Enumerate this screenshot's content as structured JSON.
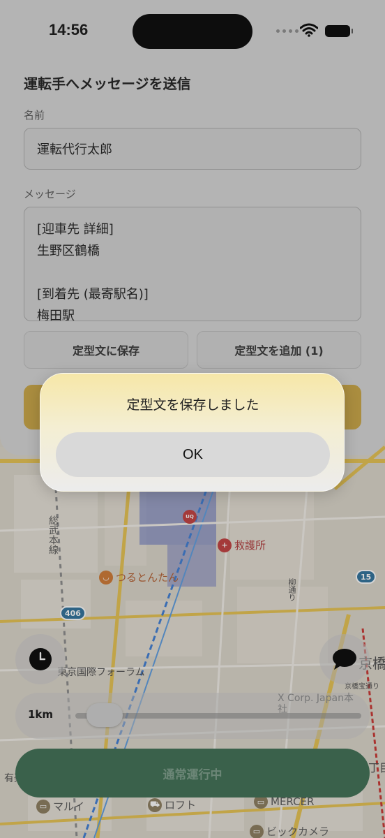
{
  "status_bar": {
    "time": "14:56",
    "wifi_icon": "wifi-icon",
    "battery_icon": "battery-icon"
  },
  "sheet": {
    "title": "運転手へメッセージを送信",
    "name_label": "名前",
    "name_value": "運転代行太郎",
    "message_label": "メッセージ",
    "message_lines": [
      "[迎車先 詳細]",
      "生野区鶴橋",
      "",
      "[到着先 (最寄駅名)]",
      "梅田駅"
    ],
    "save_template_label": "定型文に保存",
    "add_template_label": "定型文を追加 (1)",
    "send_button_color": "#c9a441"
  },
  "alert": {
    "message": "定型文を保存しました",
    "ok_label": "OK"
  },
  "map": {
    "labels": {
      "uniqlo": "UNI QLO",
      "first_aid": "救護所",
      "tsurutontan": "つるとんたん",
      "line_sobu": "総武本線",
      "tokyo_forum": "東京国際フォーラム",
      "x_corp": "X Corp. Japan本社",
      "route_406": "406",
      "route_15": "15",
      "marui": "マルイ",
      "loft": "ロフト",
      "mercer": "MERCER",
      "bic_camera": "ビックカメラ",
      "kyobashi": "京橋",
      "kyobashi_sub": "京橋宝通り",
      "yuraku": "有楽",
      "itchome": "丁目",
      "ginza_dori": "柳通り"
    }
  },
  "controls": {
    "history_icon": "clock-icon",
    "chat_icon": "chat-bubble-icon",
    "radius_label": "1km",
    "radius_fraction": 0.05,
    "status_label": "通常運行中",
    "status_color": "#3a6c50"
  }
}
